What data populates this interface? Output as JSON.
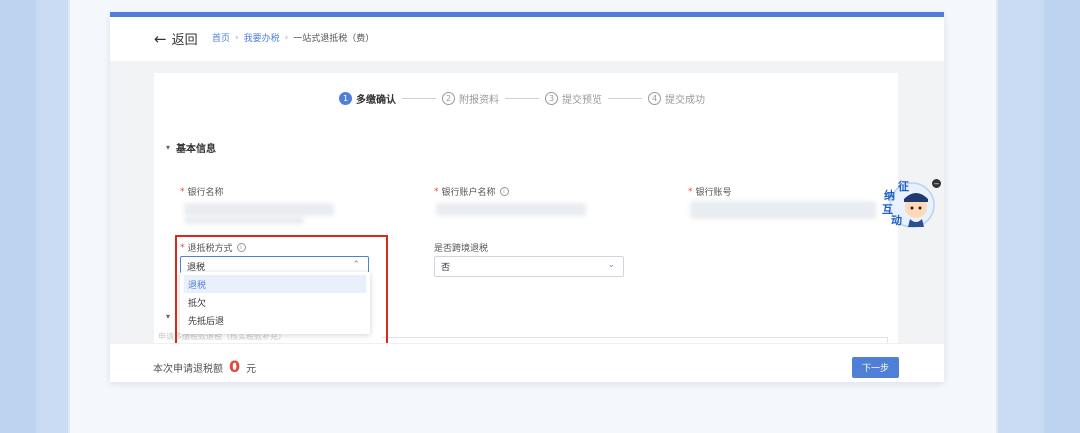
{
  "header": {
    "back_label": "返回",
    "breadcrumb": [
      "首页",
      "我要办税",
      "一站式退抵税（费）"
    ]
  },
  "steps": [
    {
      "num": "1",
      "label": "多缴确认"
    },
    {
      "num": "2",
      "label": "附报资料"
    },
    {
      "num": "3",
      "label": "提交预览"
    },
    {
      "num": "4",
      "label": "提交成功"
    }
  ],
  "section": {
    "title": "基本信息"
  },
  "fields": {
    "bank_name": {
      "label": "银行名称"
    },
    "account_name": {
      "label": "银行账户名称"
    },
    "account_no": {
      "label": "银行账号"
    },
    "refund_method": {
      "label": "退抵税方式",
      "value": "退税"
    },
    "cross_border": {
      "label": "是否跨境退税",
      "value": "否"
    }
  },
  "dropdown": {
    "options": [
      "退税",
      "抵欠",
      "先抵后退"
    ],
    "selected": "退税"
  },
  "textarea": {
    "placeholder": "申请多缴税款退税（核实税款补充）"
  },
  "footer": {
    "sum_label": "本次申请退税额",
    "amount": "0",
    "unit": "元",
    "next_label": "下一步"
  },
  "mascot": {
    "chars": [
      "征",
      "纳",
      "互",
      "动"
    ]
  },
  "colors": {
    "accent": "#4f7fd6",
    "required": "#e04a3a",
    "highlight": "#d9291c"
  }
}
